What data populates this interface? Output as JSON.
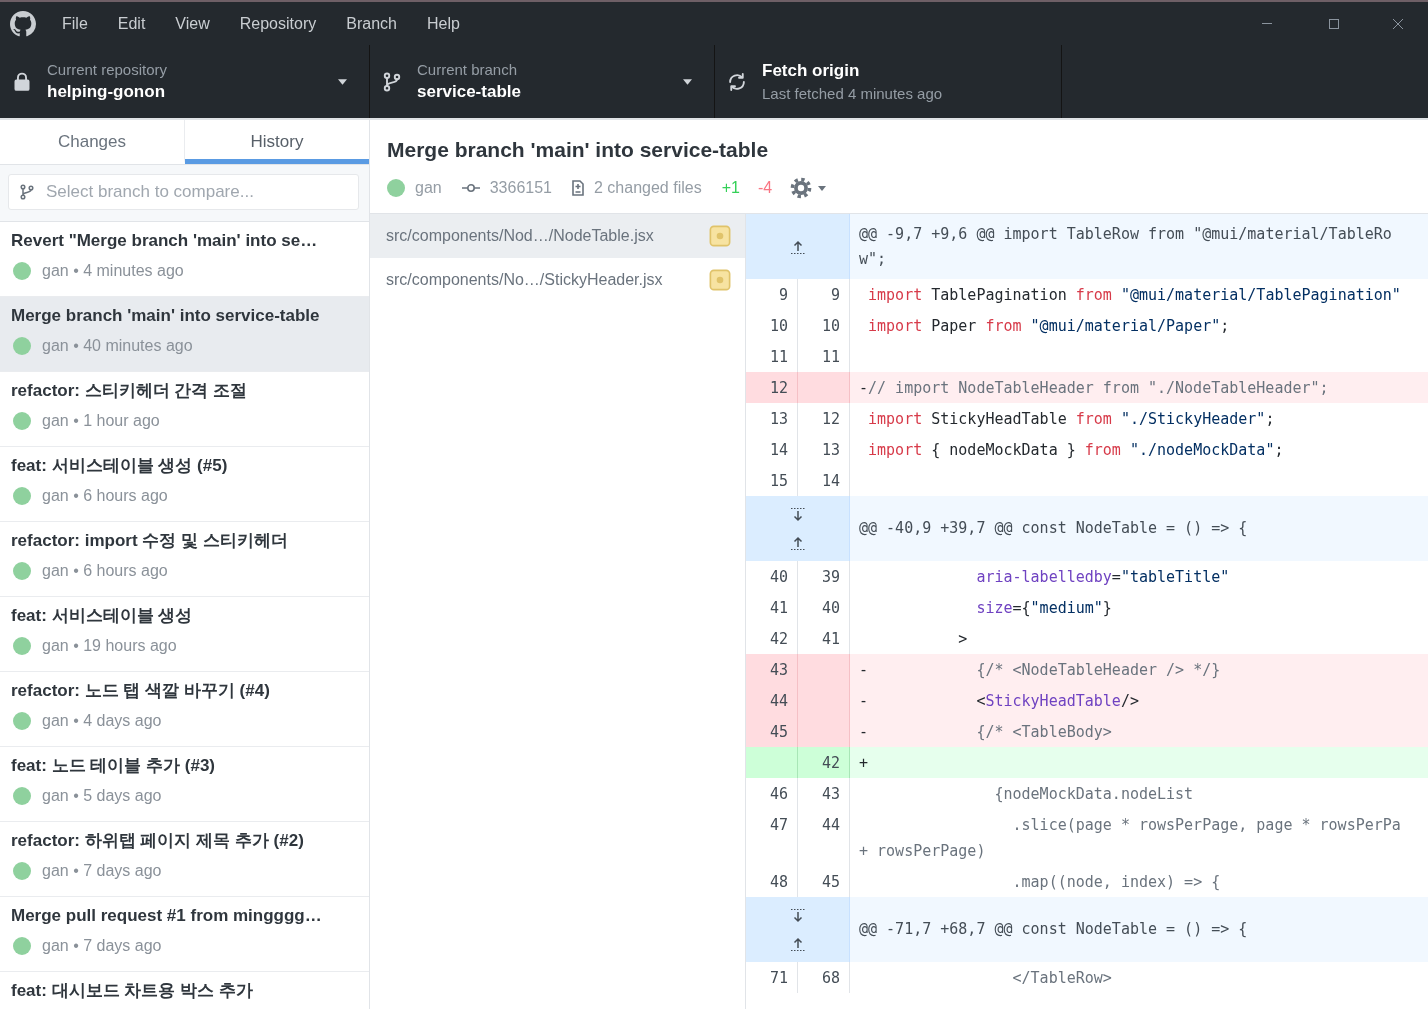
{
  "window": {
    "menu": [
      "File",
      "Edit",
      "View",
      "Repository",
      "Branch",
      "Help"
    ]
  },
  "toolbar": {
    "repository": {
      "label": "Current repository",
      "value": "helping-gonon"
    },
    "branch": {
      "label": "Current branch",
      "value": "service-table"
    },
    "fetch": {
      "label": "Fetch origin",
      "detail": "Last fetched 4 minutes ago"
    }
  },
  "tabs": [
    {
      "label": "Changes",
      "selected": false
    },
    {
      "label": "History",
      "selected": true
    }
  ],
  "compare": {
    "placeholder": "Select branch to compare..."
  },
  "commits": [
    {
      "title": "Revert \"Merge branch 'main' into se…",
      "meta": "gan • 4 minutes ago",
      "selected": false
    },
    {
      "title": "Merge branch 'main' into service-table",
      "meta": "gan • 40 minutes ago",
      "selected": true
    },
    {
      "title": "refactor: 스티키헤더 간격 조절",
      "meta": "gan • 1 hour ago",
      "selected": false
    },
    {
      "title": "feat: 서비스테이블 생성 (#5)",
      "meta": "gan • 6 hours ago",
      "selected": false
    },
    {
      "title": "refactor: import 수정 및 스티키헤더",
      "meta": "gan • 6 hours ago",
      "selected": false
    },
    {
      "title": "feat: 서비스테이블 생성",
      "meta": "gan • 19 hours ago",
      "selected": false
    },
    {
      "title": "refactor: 노드 탭 색깔 바꾸기 (#4)",
      "meta": "gan • 4 days ago",
      "selected": false
    },
    {
      "title": "feat: 노드 테이블 추가 (#3)",
      "meta": "gan • 5 days ago",
      "selected": false
    },
    {
      "title": "refactor: 하위탭 페이지 제목 추가 (#2)",
      "meta": "gan • 7 days ago",
      "selected": false
    },
    {
      "title": "Merge pull request #1 from mingggg…",
      "meta": "gan • 7 days ago",
      "selected": false
    },
    {
      "title": "feat: 대시보드 차트용 박스 추가",
      "selected": false
    }
  ],
  "commit_detail": {
    "title": "Merge branch 'main' into service-table",
    "author": "gan",
    "sha": "3366151",
    "changed_files": "2 changed files",
    "additions": "+1",
    "deletions": "-4"
  },
  "files": [
    {
      "path": "src/components/Nod…/NodeTable.jsx",
      "kind": "modified",
      "selected": true
    },
    {
      "path": "src/components/No…/StickyHeader.jsx",
      "kind": "modified",
      "selected": false
    }
  ],
  "diff": {
    "rows": [
      {
        "kind": "hunk",
        "expand_down": false,
        "expand_up": true,
        "lines": [
          "@@ -9,7 +9,6 @@ import TableRow from \"@mui/material/TableRo",
          "w\";"
        ]
      },
      {
        "kind": "context",
        "old": "9",
        "new": "9",
        "lines": [
          [
            {
              "kind": "keyword",
              "text": "import"
            },
            {
              "kind": "plain",
              "text": " TablePagination "
            },
            {
              "kind": "keyword",
              "text": "from"
            },
            {
              "kind": "string",
              "text": " \"@mui/material/TablePagination\""
            }
          ]
        ]
      },
      {
        "kind": "context",
        "old": "10",
        "new": "10",
        "lines": [
          [
            {
              "kind": "keyword",
              "text": "import"
            },
            {
              "kind": "plain",
              "text": " Paper "
            },
            {
              "kind": "keyword",
              "text": "from"
            },
            {
              "kind": "string",
              "text": " \"@mui/material/Paper\""
            },
            {
              "kind": "plain",
              "text": ";"
            }
          ]
        ]
      },
      {
        "kind": "context",
        "old": "11",
        "new": "11"
      },
      {
        "kind": "deleted",
        "old": "12",
        "marker": "-",
        "lines": [
          [
            {
              "kind": "comment",
              "text": "// import NodeTableHeader from \"./NodeTableHeader\";"
            }
          ]
        ]
      },
      {
        "kind": "context",
        "old": "13",
        "new": "12",
        "lines": [
          [
            {
              "kind": "keyword",
              "text": "import"
            },
            {
              "kind": "plain",
              "text": " StickyHeadTable "
            },
            {
              "kind": "keyword",
              "text": "from"
            },
            {
              "kind": "string",
              "text": " \"./StickyHeader\""
            },
            {
              "kind": "plain",
              "text": ";"
            }
          ]
        ]
      },
      {
        "kind": "context",
        "old": "14",
        "new": "13",
        "lines": [
          [
            {
              "kind": "keyword",
              "text": "import"
            },
            {
              "kind": "plain",
              "text": " { nodeMockData } "
            },
            {
              "kind": "keyword",
              "text": "from"
            },
            {
              "kind": "string",
              "text": " \"./nodeMockData\""
            },
            {
              "kind": "plain",
              "text": ";"
            }
          ]
        ]
      },
      {
        "kind": "context",
        "old": "15",
        "new": "14"
      },
      {
        "kind": "hunk",
        "expand_down": true,
        "expand_up": true,
        "lines": [
          "@@ -40,9 +39,7 @@ const NodeTable = () => {"
        ]
      },
      {
        "kind": "context",
        "old": "40",
        "new": "39",
        "lines": [
          [
            {
              "kind": "attr",
              "text": "            aria-labelledby"
            },
            {
              "kind": "plain",
              "text": "="
            },
            {
              "kind": "string",
              "text": "\"tableTitle\""
            }
          ]
        ]
      },
      {
        "kind": "context",
        "old": "41",
        "new": "40",
        "lines": [
          [
            {
              "kind": "attr",
              "text": "            size"
            },
            {
              "kind": "plain",
              "text": "={"
            },
            {
              "kind": "string",
              "text": "\"medium\""
            },
            {
              "kind": "plain",
              "text": "}"
            }
          ]
        ]
      },
      {
        "kind": "context",
        "old": "42",
        "new": "41",
        "lines": [
          [
            {
              "kind": "plain",
              "text": "          >"
            }
          ]
        ]
      },
      {
        "kind": "deleted",
        "old": "43",
        "marker": "-",
        "lines": [
          [
            {
              "kind": "comment",
              "text": "            {/* <NodeTableHeader /> */}"
            }
          ]
        ]
      },
      {
        "kind": "deleted",
        "old": "44",
        "marker": "-",
        "lines": [
          [
            {
              "kind": "plain",
              "text": "            <"
            },
            {
              "kind": "attr",
              "text": "StickyHeadTable"
            },
            {
              "kind": "plain",
              "text": "/>"
            }
          ]
        ]
      },
      {
        "kind": "deleted",
        "old": "45",
        "marker": "-",
        "lines": [
          [
            {
              "kind": "comment",
              "text": "            {/* <TableBody>"
            }
          ]
        ]
      },
      {
        "kind": "added",
        "new": "42",
        "marker": "+"
      },
      {
        "kind": "context",
        "old": "46",
        "new": "43",
        "lines": [
          [
            {
              "kind": "comment",
              "text": "              {nodeMockData.nodeList"
            }
          ]
        ]
      },
      {
        "kind": "context",
        "old": "47",
        "new": "44",
        "lines": [
          [
            {
              "kind": "comment",
              "text": "                .slice(page * rowsPerPage, page * rowsPerPa"
            }
          ],
          [
            {
              "kind": "comment",
              "text": "+ rowsPerPage)"
            }
          ]
        ]
      },
      {
        "kind": "context",
        "old": "48",
        "new": "45",
        "lines": [
          [
            {
              "kind": "comment",
              "text": "                .map((node, index) => {"
            }
          ]
        ]
      },
      {
        "kind": "hunk",
        "expand_down": true,
        "expand_up": true,
        "lines": [
          "@@ -71,7 +68,7 @@ const NodeTable = () => {"
        ]
      },
      {
        "kind": "context",
        "old": "71",
        "new": "68",
        "lines": [
          [
            {
              "kind": "comment",
              "text": "                </TableRow>"
            }
          ]
        ]
      }
    ]
  }
}
